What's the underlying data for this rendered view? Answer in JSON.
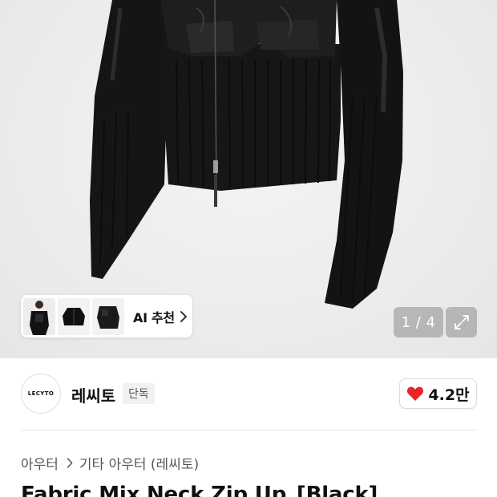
{
  "gallery": {
    "thumbnails": [
      {
        "icon": "model-front-thumbnail"
      },
      {
        "icon": "jacket-flat-thumbnail"
      },
      {
        "icon": "jacket-angle-thumbnail"
      }
    ],
    "ai_recommend_label": "AI 추천",
    "counter": "1 / 4",
    "expand_icon": "expand-arrows-icon"
  },
  "brand": {
    "logo_text": "LECYTO",
    "name": "레씨토",
    "badge": "단독"
  },
  "like": {
    "count": "4.2만",
    "heart_color": "#e8252b"
  },
  "breadcrumb": {
    "items": [
      "아우터",
      "기타 아우터 (레씨토)"
    ]
  },
  "product": {
    "title": "Fabric Mix Neck Zip Up_[Black]"
  }
}
